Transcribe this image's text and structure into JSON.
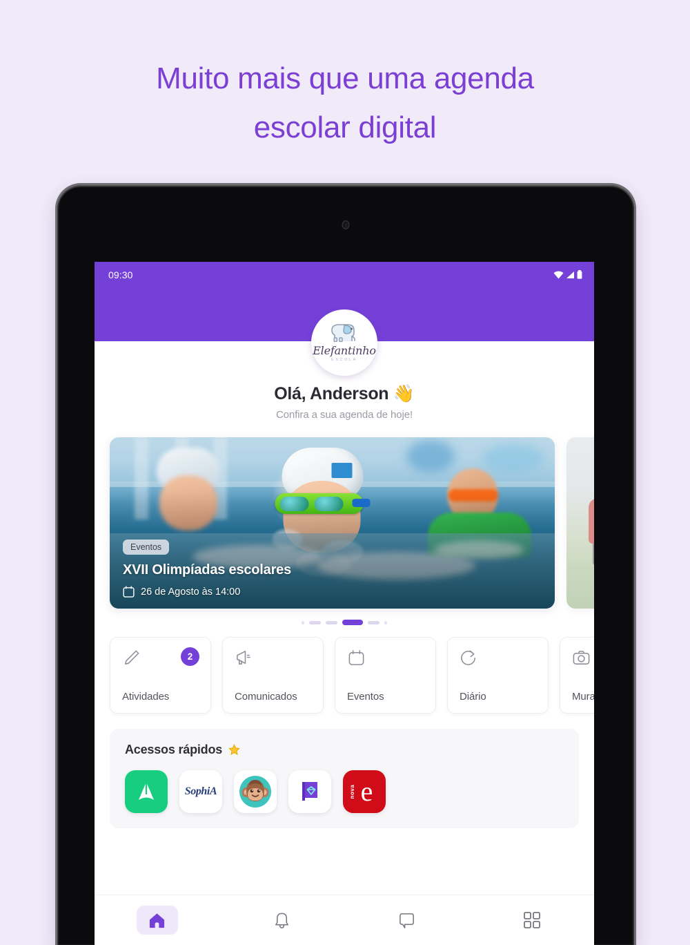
{
  "promo": {
    "headline_line1": "Muito mais que uma agenda",
    "headline_line2": "escolar digital",
    "accent_color": "#7c3fd4",
    "background_color": "#f0eaf9"
  },
  "device": {
    "type": "tablet",
    "bezel_color": "#0b0b0d"
  },
  "statusbar": {
    "time": "09:30",
    "icons": [
      "wifi-icon",
      "signal-icon",
      "battery-icon"
    ],
    "background_color": "#7440d8"
  },
  "app_header": {
    "logo_name": "Elefantinho",
    "logo_subtitle": "ESCOLA",
    "logo_icon": "elephant-icon",
    "background_color": "#7440d8"
  },
  "greeting": {
    "title": "Olá, Anderson 👋",
    "subtitle": "Confira a sua agenda de hoje!"
  },
  "carousel": {
    "slides": [
      {
        "badge": "Eventos",
        "title": "XVII Olimpíadas escolares",
        "date_icon": "calendar-icon",
        "date": "26 de Agosto às 14:00",
        "image_alt": "swimming-pool-photo"
      },
      {
        "image_alt": "child-on-field-photo"
      }
    ],
    "indicators": {
      "count": 5,
      "active_index": 2,
      "active_color": "#7440d8",
      "inactive_color": "#ddd6ec"
    }
  },
  "tiles": [
    {
      "label": "Atividades",
      "icon": "pencil-icon",
      "badge": "2"
    },
    {
      "label": "Comunicados",
      "icon": "megaphone-icon",
      "badge": ""
    },
    {
      "label": "Eventos",
      "icon": "calendar-icon",
      "badge": ""
    },
    {
      "label": "Diário",
      "icon": "refresh-icon",
      "badge": ""
    },
    {
      "label": "Mural",
      "icon": "camera-icon",
      "badge": ""
    }
  ],
  "quick_access": {
    "title": "Acessos rápidos",
    "title_icon": "star-icon",
    "apps": [
      {
        "name": "agenda-app",
        "label": "A",
        "icon": "arrow-logo-icon",
        "color": "#17ce80"
      },
      {
        "name": "sophia-app",
        "label": "SophiA",
        "icon": "sophia-logo-icon",
        "color": "#ffffff"
      },
      {
        "name": "monkey-app",
        "label": "",
        "icon": "monkey-face-icon",
        "color": "#3fc4bd"
      },
      {
        "name": "book-app",
        "label": "",
        "icon": "book-heart-icon",
        "color": "#7440d8"
      },
      {
        "name": "escola-app",
        "label": "e",
        "icon": "nova-escola-icon",
        "color": "#cf0c18",
        "sublabel": "nova"
      }
    ]
  },
  "bottom_nav": {
    "items": [
      {
        "name": "home",
        "icon": "home-icon",
        "active": true
      },
      {
        "name": "notifications",
        "icon": "bell-icon",
        "active": false
      },
      {
        "name": "messages",
        "icon": "chat-bubble-icon",
        "active": false
      },
      {
        "name": "apps",
        "icon": "grid-icon",
        "active": false
      }
    ],
    "active_pill_color": "#efe8fb",
    "active_icon_color": "#7440d8"
  }
}
